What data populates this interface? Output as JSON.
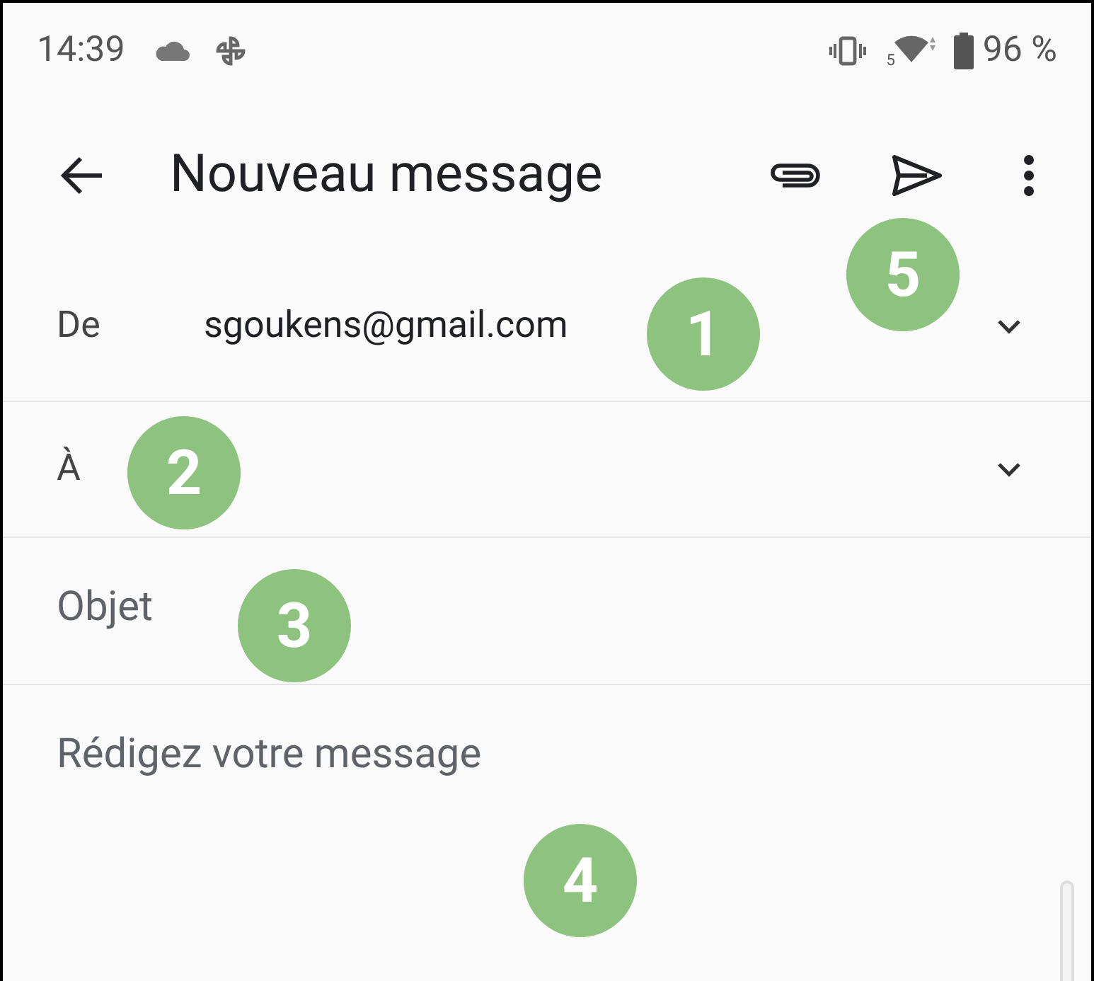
{
  "status_bar": {
    "time": "14:39",
    "wifi_band": "5",
    "battery": "96 %"
  },
  "toolbar": {
    "title": "Nouveau message"
  },
  "from": {
    "label": "De",
    "value": "sgoukens@gmail.com"
  },
  "to": {
    "label": "À"
  },
  "subject": {
    "placeholder": "Objet"
  },
  "body": {
    "placeholder": "Rédigez votre message"
  },
  "callouts": [
    {
      "number": "1"
    },
    {
      "number": "2"
    },
    {
      "number": "3"
    },
    {
      "number": "4"
    },
    {
      "number": "5"
    }
  ]
}
